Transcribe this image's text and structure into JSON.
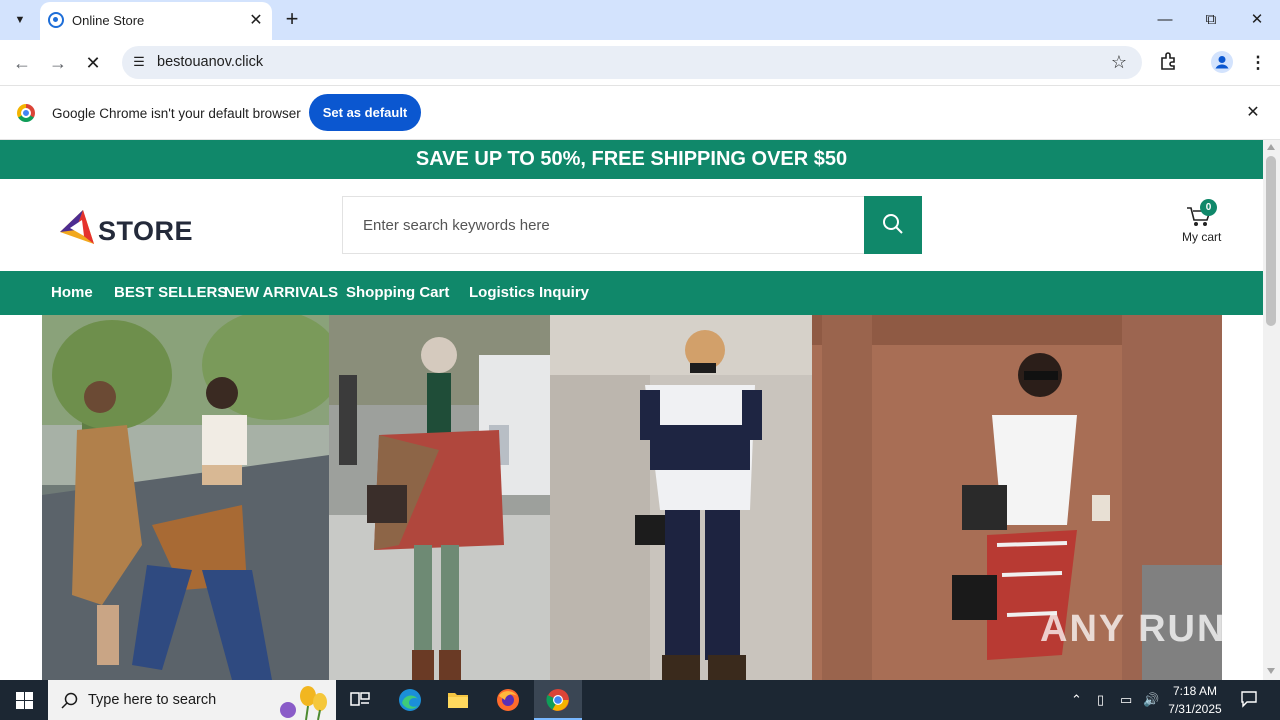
{
  "browser": {
    "tab_title": "Online Store",
    "url": "bestouanov.click",
    "infobar_message": "Google Chrome isn't your default browser",
    "set_default_label": "Set as default"
  },
  "store": {
    "promo_banner": "SAVE UP TO 50%, FREE SHIPPING OVER $50",
    "logo_text": "STORE",
    "search_placeholder": "Enter search keywords here",
    "cart_count": "0",
    "cart_label": "My cart",
    "nav": [
      {
        "label": "Home"
      },
      {
        "label": "BEST SELLERS"
      },
      {
        "label": "NEW ARRIVALS"
      },
      {
        "label": "Shopping Cart"
      },
      {
        "label": "Logistics Inquiry"
      }
    ],
    "accent_color": "#10886a"
  },
  "watermark": "ANY RUN",
  "taskbar": {
    "search_placeholder": "Type here to search",
    "time": "7:18 AM",
    "date": "7/31/2025"
  }
}
